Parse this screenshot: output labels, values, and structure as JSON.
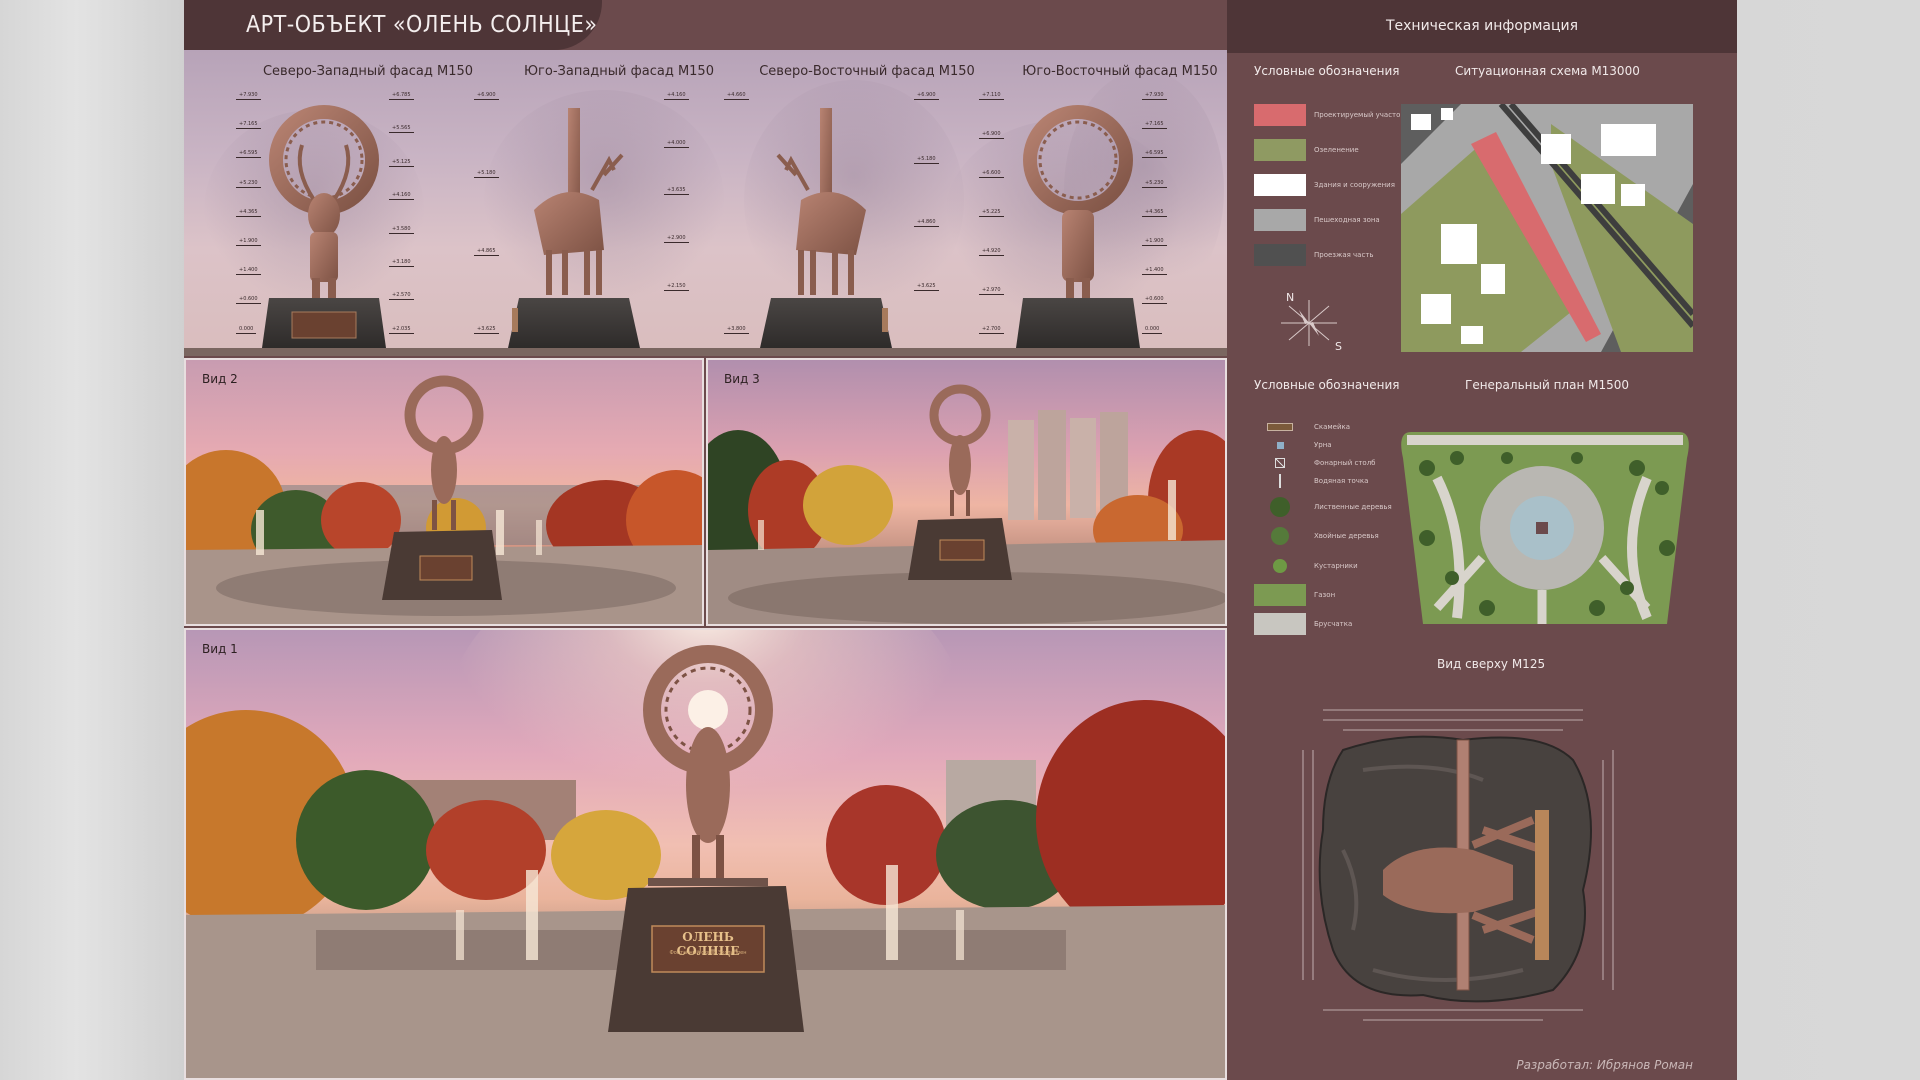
{
  "header": {
    "title": "АРТ-ОБЪЕКТ «ОЛЕНЬ СОЛНЦЕ»"
  },
  "facades": [
    {
      "title": "Северо-Западный фасад М150"
    },
    {
      "title": "Юго-Западный фасад М150"
    },
    {
      "title": "Северо-Восточный фасад М150"
    },
    {
      "title": "Юго-Восточный фасад М150"
    }
  ],
  "elevation_marks": {
    "nw_left": [
      "+7.930",
      "+7.165",
      "+6.595",
      "+5.230",
      "+4.365",
      "+1.900",
      "+1.400",
      "+0.600",
      "0.000"
    ],
    "nw_right": [
      "+6.785",
      "+5.565",
      "+5.125",
      "+4.160",
      "+3.580",
      "+3.180",
      "+2.570",
      "+2.035"
    ],
    "sw_left": [
      "+6.900",
      "+5.180",
      "+4.865",
      "+3.625"
    ],
    "sw_right": [
      "+4.160",
      "+4.000",
      "+3.635",
      "+2.900",
      "+2.150"
    ],
    "ne_left": [
      "+4.660",
      "+3.800"
    ],
    "ne_right": [
      "+6.900",
      "+5.180",
      "+4.860",
      "+3.625"
    ],
    "se_left": [
      "+7.110",
      "+6.900",
      "+6.600",
      "+5.225",
      "+4.920",
      "+2.970",
      "+2.700"
    ],
    "se_right": [
      "+7.930",
      "+7.165",
      "+6.595",
      "+5.230",
      "+4.365",
      "+1.900",
      "+1.400",
      "+0.600",
      "0.000"
    ]
  },
  "views": {
    "view2": {
      "label": "Вид 2"
    },
    "view3": {
      "label": "Вид 3"
    },
    "view1": {
      "label": "Вид 1"
    }
  },
  "plaque": {
    "name": "ОЛЕНЬ СОЛНЦЕ",
    "sub": "Фонтанный сквер Экслиппен"
  },
  "right_panel": {
    "title": "Техническая информация",
    "legend1_title": "Условные обозначения",
    "situation_title": "Ситуационная схема М13000",
    "legend1": [
      {
        "label": "Проектируемый участок",
        "color": "#d86b6e"
      },
      {
        "label": "Озеленение",
        "color": "#8f9a62"
      },
      {
        "label": "Здания и сооружения",
        "color": "#ffffff"
      },
      {
        "label": "Пешеходная зона",
        "color": "#a8a8a8"
      },
      {
        "label": "Проезжая часть",
        "color": "#505050"
      }
    ],
    "compass_n": "N",
    "compass_s": "S",
    "legend2_title": "Условные обозначения",
    "genplan_title": "Генеральный план М1500",
    "legend2": [
      {
        "label": "Скамейка"
      },
      {
        "label": "Урна"
      },
      {
        "label": "Фонарный столб"
      },
      {
        "label": "Водяная точка"
      },
      {
        "label": "Лиственные деревья"
      },
      {
        "label": "Хвойные деревья"
      },
      {
        "label": "Кустарники"
      },
      {
        "label": "Газон"
      },
      {
        "label": "Брусчатка"
      }
    ],
    "topview_title": "Вид сверху М125",
    "author": "Разработал: Ибрянов Роман"
  },
  "colors": {
    "board": "#6b4a4c",
    "header": "#4e3537",
    "statue": "#9a6a5a",
    "pedestal": "#3e3a38"
  }
}
